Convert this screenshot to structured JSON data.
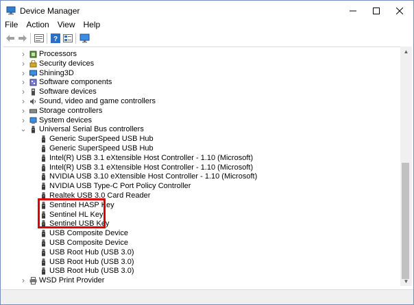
{
  "window": {
    "title": "Device Manager",
    "buttons": {
      "minimize": "—",
      "maximize": "☐",
      "close": "✕"
    }
  },
  "menu": [
    "File",
    "Action",
    "View",
    "Help"
  ],
  "toolbar": {
    "icons": [
      "back-arrow-icon",
      "forward-arrow-icon",
      "properties-icon",
      "help-icon",
      "view-list-icon",
      "monitor-icon"
    ]
  },
  "tree": {
    "categories_top": [
      {
        "label": "Processors",
        "icon": "processor-icon"
      },
      {
        "label": "Security devices",
        "icon": "security-icon"
      },
      {
        "label": "Shining3D",
        "icon": "device-icon"
      },
      {
        "label": "Software components",
        "icon": "software-component-icon"
      },
      {
        "label": "Software devices",
        "icon": "software-device-icon"
      },
      {
        "label": "Sound, video and game controllers",
        "icon": "sound-icon"
      },
      {
        "label": "Storage controllers",
        "icon": "storage-icon"
      },
      {
        "label": "System devices",
        "icon": "system-icon"
      }
    ],
    "usb_category": "Universal Serial Bus controllers",
    "usb_children": [
      "Generic SuperSpeed USB Hub",
      "Generic SuperSpeed USB Hub",
      "Intel(R) USB 3.1 eXtensible Host Controller - 1.10 (Microsoft)",
      "Intel(R) USB 3.1 eXtensible Host Controller - 1.10 (Microsoft)",
      "NVIDIA USB 3.10 eXtensible Host Controller - 1.10 (Microsoft)",
      "NVIDIA USB Type-C Port Policy Controller",
      "Realtek USB 3.0 Card Reader",
      "Sentinel HASP Key",
      "Sentinel HL Key",
      "Sentinel USB Key",
      "USB Composite Device",
      "USB Composite Device",
      "USB Root Hub (USB 3.0)",
      "USB Root Hub (USB 3.0)",
      "USB Root Hub (USB 3.0)"
    ],
    "categories_bottom": [
      {
        "label": "WSD Print Provider",
        "icon": "printer-icon"
      }
    ]
  },
  "colors": {
    "highlight": "#e00000",
    "accent": "#1e6fc0"
  }
}
